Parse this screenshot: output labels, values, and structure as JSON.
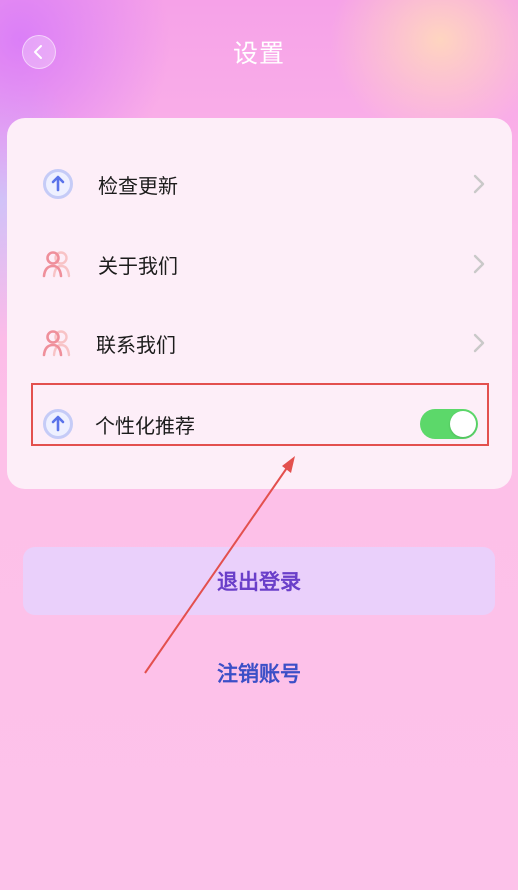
{
  "header": {
    "title": "设置",
    "back_icon": "chevron-left-icon"
  },
  "settings": {
    "items": [
      {
        "label": "检查更新",
        "icon": "upload-arrow-icon",
        "control": "chevron"
      },
      {
        "label": "关于我们",
        "icon": "users-icon",
        "control": "chevron"
      },
      {
        "label": "联系我们",
        "icon": "users-icon",
        "control": "chevron"
      },
      {
        "label": "个性化推荐",
        "icon": "upload-arrow-icon",
        "control": "toggle",
        "toggle_on": true
      }
    ]
  },
  "actions": {
    "logout_label": "退出登录",
    "cancel_account_label": "注销账号"
  },
  "colors": {
    "toggle_on": "#5cd86a",
    "highlight_box": "#e3504e",
    "annotation_arrow": "#e3504e",
    "logout_text": "#6a3fc9",
    "cancel_text": "#3b4fc7"
  }
}
